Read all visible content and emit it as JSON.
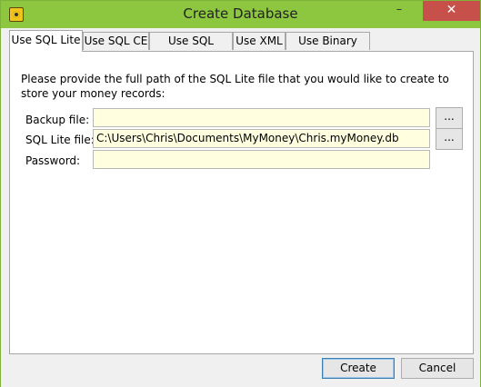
{
  "window": {
    "title": "Create Database",
    "minimize": "–",
    "close": "✕"
  },
  "tabs": [
    {
      "label": "Use SQL Lite",
      "active": true
    },
    {
      "label": "Use SQL CE"
    },
    {
      "label": "Use SQL Server"
    },
    {
      "label": "Use XML"
    },
    {
      "label": "Use Binary XML"
    }
  ],
  "panel": {
    "description": "Please provide the full path of the SQL Lite file that you would like to create to store your money records:",
    "backup_label": "Backup file:",
    "backup_value": "",
    "sqllite_label": "SQL Lite file:",
    "sqllite_value": "C:\\Users\\Chris\\Documents\\MyMoney\\Chris.myMoney.db",
    "password_label": "Password:",
    "password_value": "",
    "browse_label": "..."
  },
  "buttons": {
    "create": "Create",
    "cancel": "Cancel"
  },
  "colors": {
    "titlebar": "#8dc63f",
    "close": "#c7504a",
    "input_bg": "#ffffe0"
  },
  "icons": {
    "app": "app-icon"
  }
}
